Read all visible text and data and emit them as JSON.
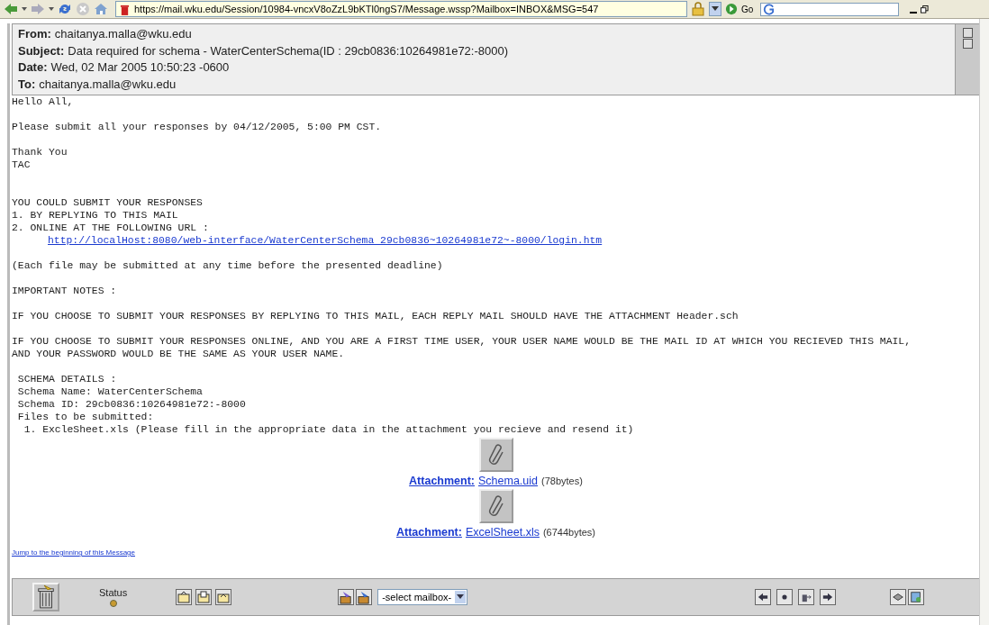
{
  "browser": {
    "url": "https://mail.wku.edu/Session/10984-vncxV8oZzL9bKTl0ngS7/Message.wssp?Mailbox=INBOX&MSG=547",
    "go_label": "Go"
  },
  "header": [
    {
      "label": "From:",
      "value": "chaitanya.malla@wku.edu"
    },
    {
      "label": "Subject:",
      "value": "Data required for schema - WaterCenterSchema(ID : 29cb0836:10264981e72:-8000)"
    },
    {
      "label": "Date:",
      "value": "Wed, 02 Mar 2005 10:50:23 -0600"
    },
    {
      "label": "To:",
      "value": "chaitanya.malla@wku.edu"
    }
  ],
  "body": [
    {
      "kind": "text",
      "text": "Hello All,"
    },
    {
      "kind": "gap"
    },
    {
      "kind": "text",
      "text": "Please submit all your responses by 04/12/2005, 5:00 PM CST."
    },
    {
      "kind": "gap"
    },
    {
      "kind": "text",
      "text": "Thank You\nTAC"
    },
    {
      "kind": "gap"
    },
    {
      "kind": "gap"
    },
    {
      "kind": "text",
      "text": "YOU COULD SUBMIT YOUR RESPONSES\n1. BY REPLYING TO THIS MAIL\n2. ONLINE AT THE FOLLOWING URL :"
    },
    {
      "kind": "link",
      "text": "http://localHost:8080/web-interface/WaterCenterSchema 29cb0836~10264981e72~-8000/login.htm"
    },
    {
      "kind": "gap"
    },
    {
      "kind": "text",
      "text": "(Each file may be submitted at any time before the presented deadline)"
    },
    {
      "kind": "gap"
    },
    {
      "kind": "text",
      "text": "IMPORTANT NOTES :"
    },
    {
      "kind": "gap"
    },
    {
      "kind": "text",
      "text": "IF YOU CHOOSE TO SUBMIT YOUR RESPONSES BY REPLYING TO THIS MAIL, EACH REPLY MAIL SHOULD HAVE THE ATTACHMENT Header.sch"
    },
    {
      "kind": "gap"
    },
    {
      "kind": "text",
      "text": "IF YOU CHOOSE TO SUBMIT YOUR RESPONSES ONLINE, AND YOU ARE A FIRST TIME USER, YOUR USER NAME WOULD BE THE MAIL ID AT WHICH YOU RECIEVED THIS MAIL,\nAND YOUR PASSWORD WOULD BE THE SAME AS YOUR USER NAME."
    },
    {
      "kind": "gap"
    },
    {
      "kind": "text",
      "text": " SCHEMA DETAILS :\n Schema Name: WaterCenterSchema\n Schema ID: 29cb0836:10264981e72:-8000\n Files to be submitted:\n  1. ExcleSheet.xls (Please fill in the appropriate data in the attachment you recieve and resend it)"
    }
  ],
  "attachments": [
    {
      "label": "Attachment:",
      "name": "Schema.uid",
      "size": "(78bytes)"
    },
    {
      "label": "Attachment:",
      "name": "ExcelSheet.xls",
      "size": "(6744bytes)"
    }
  ],
  "jump_link": "Jump to the beginning of this Message",
  "toolbar": {
    "status_label": "Status",
    "mailbox_select": "-select mailbox-"
  }
}
